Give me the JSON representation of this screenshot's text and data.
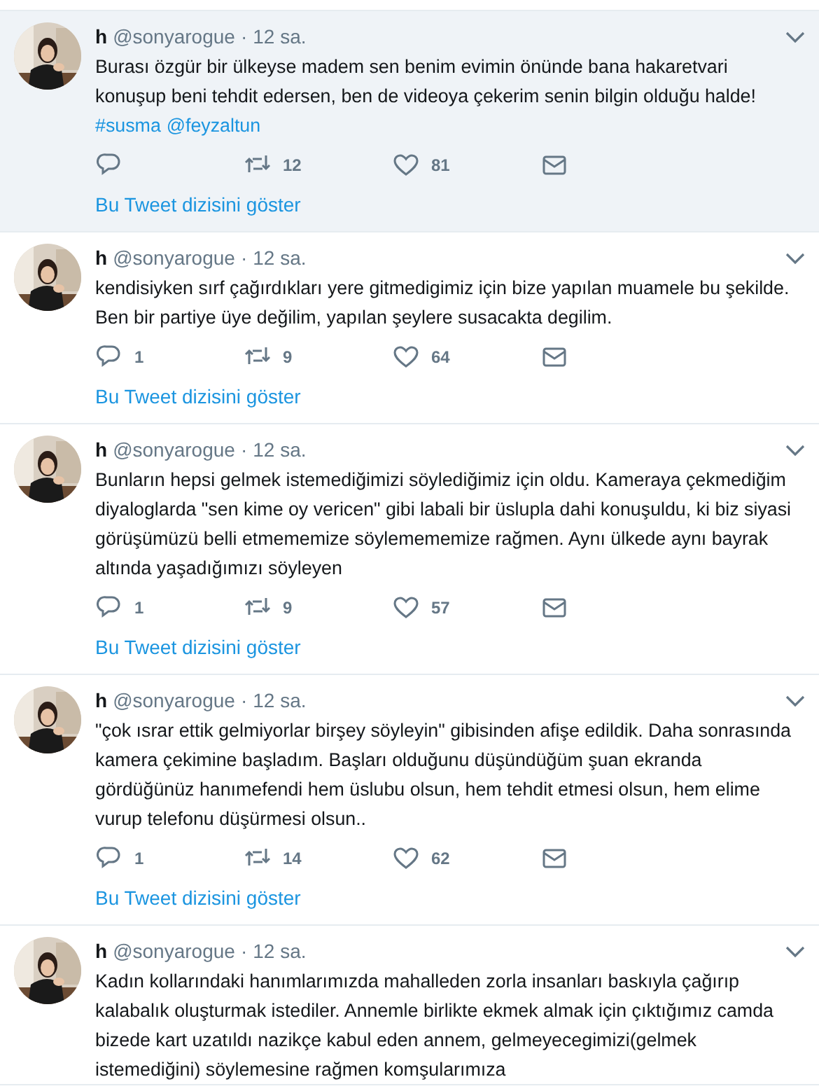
{
  "tweets": [
    {
      "highlighted": true,
      "name": "h",
      "handle": "@sonyarogue",
      "separator": "·",
      "time": "12 sa.",
      "text": "Burası özgür bir ülkeyse madem sen benim evimin önünde bana hakaretvari konuşup beni tehdit edersen, ben de videoya çekerim senin bilgin olduğu halde!",
      "links": [
        {
          "text": "#susma"
        },
        {
          "text": "@feyzaltun"
        }
      ],
      "actions": {
        "retweets": "12",
        "likes": "81"
      },
      "thread_link": "Bu Tweet dizisini göster"
    },
    {
      "highlighted": false,
      "name": "h",
      "handle": "@sonyarogue",
      "separator": "·",
      "time": "12 sa.",
      "text": "kendisiyken sırf çağırdıkları yere gitmedigimiz için bize yapılan  muamele bu şekilde. Ben bir partiye üye değilim, yapılan şeylere susacakta degilim.",
      "actions": {
        "replies": "1",
        "retweets": "9",
        "likes": "64"
      },
      "thread_link": "Bu Tweet dizisini göster"
    },
    {
      "highlighted": false,
      "name": "h",
      "handle": "@sonyarogue",
      "separator": "·",
      "time": "12 sa.",
      "text": "Bunların hepsi gelmek istemediğimizi söylediğimiz için oldu. Kameraya çekmediğim diyaloglarda \"sen kime oy vericen\" gibi labali bir üslupla dahi konuşuldu, ki biz siyasi görüşümüzü belli etmememize söylemememize rağmen. Aynı ülkede aynı bayrak altında yaşadığımızı söyleyen",
      "actions": {
        "replies": "1",
        "retweets": "9",
        "likes": "57"
      },
      "thread_link": "Bu Tweet dizisini göster"
    },
    {
      "highlighted": false,
      "name": "h",
      "handle": "@sonyarogue",
      "separator": "·",
      "time": "12 sa.",
      "text": "\"çok ısrar ettik gelmiyorlar birşey söyleyin\" gibisinden afişe edildik. Daha sonrasında kamera çekimine başladım. Başları olduğunu düşündüğüm şuan ekranda gördüğünüz hanımefendi hem üslubu olsun, hem tehdit etmesi olsun, hem elime vurup telefonu düşürmesi olsun..",
      "actions": {
        "replies": "1",
        "retweets": "14",
        "likes": "62"
      },
      "thread_link": "Bu Tweet dizisini göster"
    },
    {
      "highlighted": false,
      "name": "h",
      "handle": "@sonyarogue",
      "separator": "·",
      "time": "12 sa.",
      "text": "Kadın kollarındaki hanımlarımızda mahalleden zorla insanları baskıyla çağırıp kalabalık oluşturmak istediler. Annemle birlikte ekmek almak için çıktığımız camda bizede kart uzatıldı nazikçe kabul eden annem, gelmeyecegimizi(gelmek istemediğini) söylemesine rağmen komşularımıza"
    }
  ]
}
